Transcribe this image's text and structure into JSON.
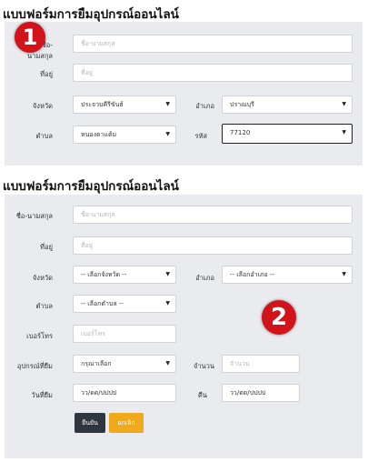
{
  "form1": {
    "title": "แบบฟอร์มการยืมอุปกรณ์ออนไลน์",
    "badge": "1",
    "name_label": "ชื่อ-นามสกุล",
    "name_placeholder": "ชื่อ-นามสกุล",
    "address_label": "ที่อยู่",
    "address_placeholder": "ที่อยู่",
    "province_label": "จังหวัด",
    "province_value": "ประจวบคีรีขันธ์",
    "district_label": "อำเภอ",
    "district_value": "ปราณบุรี",
    "subdistrict_label": "ตำบล",
    "subdistrict_value": "หนองตาแต้ม",
    "zip_label": "รหัส",
    "zip_value": "77120"
  },
  "form2": {
    "title": "แบบฟอร์มการยืมอุปกรณ์ออนไลน์",
    "badge": "2",
    "name_label": "ชื่อ-นามสกุล",
    "name_placeholder": "ชื่อ-นามสกุล",
    "address_label": "ที่อยู่",
    "address_placeholder": "ที่อยู่",
    "province_label": "จังหวัด",
    "province_value": "-- เลือกจังหวัด --",
    "district_label": "อำเภอ",
    "district_value": "-- เลือกอำเภอ --",
    "subdistrict_label": "ตำบล",
    "subdistrict_value": "-- เลือกตำบล --",
    "phone_label": "เบอร์โทร",
    "phone_placeholder": "เบอร์โทร",
    "equipment_label": "อุปกรณ์ที่ยืม",
    "equipment_value": "กรุณาเลือก",
    "qty_label": "จำนวน",
    "qty_placeholder": "จำนวน",
    "borrow_date_label": "วันที่ยืม",
    "borrow_date_value": "วว/ดด/ปปปป",
    "return_date_label": "คืน",
    "return_date_value": "วว/ดด/ปปปป",
    "confirm_label": "ยืนยัน",
    "cancel_label": "ยกเลิก"
  },
  "colors": {
    "badge": "#d2131a",
    "confirm": "#2e3640",
    "cancel": "#f0a81c",
    "panel": "#e9ebee"
  }
}
